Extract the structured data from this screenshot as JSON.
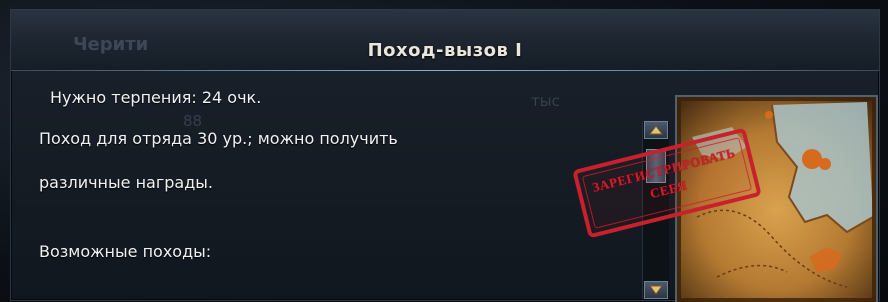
{
  "background": {
    "ghost_title": "Черити",
    "ghost_number": "88",
    "ghost_suffix": "тыс"
  },
  "panel": {
    "title": "Поход-вызов I",
    "requirement": "Нужно терпения: 24 очк.",
    "description_line1": "Поход для отряда 30 ур.; можно получить",
    "description_line2": "различные награды.",
    "possible_label": "Возможные походы:"
  },
  "stamp": {
    "line1": "ЗАРЕГИСТРИРОВАТЬ",
    "line2": "СЕБЯ"
  },
  "colors": {
    "stamp_red": "#c8212d",
    "title_text": "#e9e6dc",
    "body_text": "#f2f2f2"
  },
  "icons": {
    "scroll_up": "triangle-up-icon",
    "scroll_down": "triangle-down-icon"
  }
}
